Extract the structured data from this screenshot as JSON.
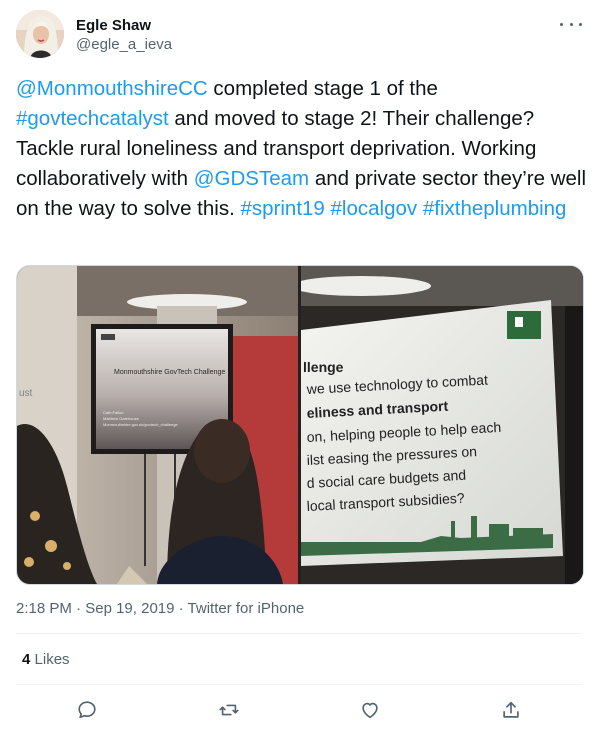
{
  "author": {
    "display_name": "Egle Shaw",
    "handle": "@egle_a_ieva"
  },
  "tweet": {
    "segments": [
      {
        "text": "@MonmouthshireCC",
        "link": true
      },
      {
        "text": " completed stage 1 of the ",
        "link": false
      },
      {
        "text": "#govtechcatalyst",
        "link": true
      },
      {
        "text": " and moved to stage 2! Their challenge? Tackle rural loneliness and transport deprivation. Working collaboratively with ",
        "link": false
      },
      {
        "text": "@GDSTeam",
        "link": true
      },
      {
        "text": " and private sector they’re well on the way to solve this. ",
        "link": false
      },
      {
        "text": "#sprint19",
        "link": true
      },
      {
        "text": " ",
        "link": false
      },
      {
        "text": "#localgov",
        "link": true
      },
      {
        "text": " ",
        "link": false
      },
      {
        "text": "#fixtheplumbing",
        "link": true
      }
    ]
  },
  "photo_left": {
    "slide_title": "Monmouthshire GovTech Challenge",
    "slide_lines": [
      "Cath Fallon",
      "Matthew Gatehouse",
      "Monmouthshire.gov.uk/govtech_challenge"
    ],
    "wall_text": "ust"
  },
  "photo_right": {
    "heading": "llenge",
    "lines": [
      "we use technology to combat",
      "eliness and transport",
      "on, helping people to help each",
      "ilst easing the pressures on",
      "d social care budgets and",
      "local transport subsidies?"
    ]
  },
  "meta": {
    "time": "2:18 PM",
    "date": "Sep 19, 2019",
    "source": "Twitter for iPhone",
    "separator": " · "
  },
  "likes": {
    "count": "4",
    "label": "Likes"
  },
  "icons": {
    "reply": "reply-icon",
    "retweet": "retweet-icon",
    "like": "heart-icon",
    "share": "share-icon",
    "more": "more-icon"
  },
  "colors": {
    "link": "#1d9bf0",
    "secondary_text": "#536471",
    "primary_text": "#0f1419"
  }
}
